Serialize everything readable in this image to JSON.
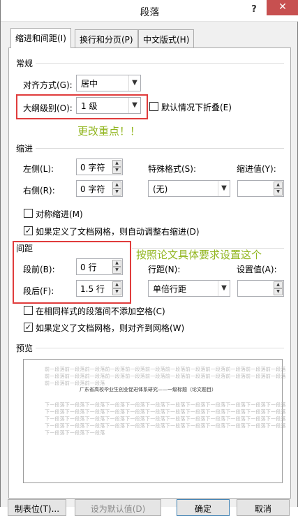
{
  "window": {
    "title": "段落",
    "help": "?",
    "close": "✕"
  },
  "tabs": [
    {
      "label": "缩进和间距(I)",
      "active": true
    },
    {
      "label": "换行和分页(P)",
      "active": false
    },
    {
      "label": "中文版式(H)",
      "active": false
    }
  ],
  "general": {
    "title": "常规",
    "alignment_label": "对齐方式(G):",
    "alignment_value": "居中",
    "outline_label": "大纲级别(O):",
    "outline_value": "1 级",
    "collapse_label": "默认情况下折叠(E)"
  },
  "indent": {
    "title": "缩进",
    "left_label": "左侧(L):",
    "left_value": "0 字符",
    "right_label": "右侧(R):",
    "right_value": "0 字符",
    "special_label": "特殊格式(S):",
    "special_value": "(无)",
    "indent_value_label": "缩进值(Y):",
    "indent_value": "",
    "mirror_label": "对称缩进(M)",
    "mirror_checked": false,
    "auto_adjust_label": "如果定义了文档网格，则自动调整右缩进(D)",
    "auto_adjust_checked": true
  },
  "spacing": {
    "title": "间距",
    "before_label": "段前(B):",
    "before_value": "0 行",
    "after_label": "段后(F):",
    "after_value": "1.5 行",
    "line_label": "行距(N):",
    "line_value": "单倍行距",
    "setting_label": "设置值(A):",
    "setting_value": "",
    "no_space_label": "在相同样式的段落间不添加空格(C)",
    "no_space_checked": false,
    "snap_grid_label": "如果定义了文档网格，则对齐到网格(W)",
    "snap_grid_checked": true
  },
  "preview": {
    "title": "预览",
    "prev_lines": [
      "前一段落前一段落前一段落前一段落前一段落前一段落前一段落前一段落前一段落前一段落前一段落前一段落",
      "前一段落前一段落前一段落前一段落前一段落前一段落前一段落前一段落前一段落前一段落前一段落前一段落",
      "前一段落前一段落前一段落"
    ],
    "sample_text": "广东省高校毕业生创业促进体系研究——一级标题（论文题目）",
    "next_lines": [
      "下一段落下一段落下一段落下一段落下一段落下一段落下一段落下一段落下一段落下一段落下一段落下一段落",
      "下一段落下一段落下一段落下一段落下一段落下一段落下一段落下一段落下一段落下一段落下一段落下一段落",
      "下一段落下一段落下一段落下一段落下一段落下一段落下一段落下一段落下一段落下一段落下一段落下一段落",
      "下一段落下一段落下一段落下一段落下一段落下一段落下一段落下一段落下一段落下一段落下一段落下一段落",
      "下一段落下一段落下一段落"
    ]
  },
  "annotations": {
    "outline_note": "更改重点！！",
    "spacing_note": "按照论文具体要求设置这个",
    "color": "#92b620",
    "highlight_color": "#e03c3c"
  },
  "buttons": {
    "tabs_button": "制表位(T)...",
    "default_button": "设为默认值(D)",
    "ok_button": "确定",
    "cancel_button": "取消"
  }
}
